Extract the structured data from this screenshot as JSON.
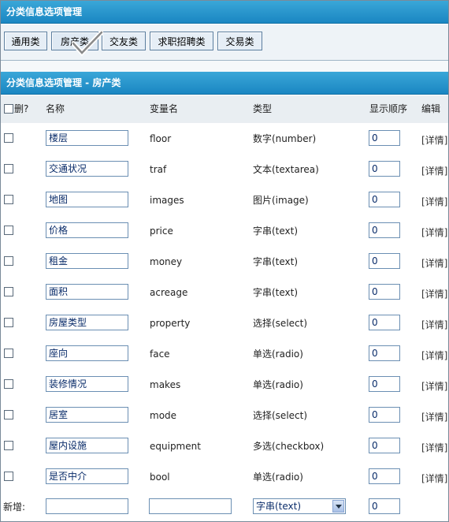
{
  "top_title": "分类信息选项管理",
  "tabs": [
    {
      "label": "通用类"
    },
    {
      "label": "房产类"
    },
    {
      "label": "交友类"
    },
    {
      "label": "求职招聘类"
    },
    {
      "label": "交易类"
    }
  ],
  "section_title": "分类信息选项管理 - 房产类",
  "columns": {
    "del": "删?",
    "name": "名称",
    "var": "变量名",
    "type": "类型",
    "order": "显示顺序",
    "edit": "编辑"
  },
  "rows": [
    {
      "name": "楼层",
      "var": "floor",
      "type": "数字(number)",
      "order": "0",
      "edit": "[详情]"
    },
    {
      "name": "交通状况",
      "var": "traf",
      "type": "文本(textarea)",
      "order": "0",
      "edit": "[详情]"
    },
    {
      "name": "地图",
      "var": "images",
      "type": "图片(image)",
      "order": "0",
      "edit": "[详情]"
    },
    {
      "name": "价格",
      "var": "price",
      "type": "字串(text)",
      "order": "0",
      "edit": "[详情]"
    },
    {
      "name": "租金",
      "var": "money",
      "type": "字串(text)",
      "order": "0",
      "edit": "[详情]"
    },
    {
      "name": "面积",
      "var": "acreage",
      "type": "字串(text)",
      "order": "0",
      "edit": "[详情]"
    },
    {
      "name": "房屋类型",
      "var": "property",
      "type": "选择(select)",
      "order": "0",
      "edit": "[详情]"
    },
    {
      "name": "座向",
      "var": "face",
      "type": "单选(radio)",
      "order": "0",
      "edit": "[详情]"
    },
    {
      "name": "装修情况",
      "var": "makes",
      "type": "单选(radio)",
      "order": "0",
      "edit": "[详情]"
    },
    {
      "name": "居室",
      "var": "mode",
      "type": "选择(select)",
      "order": "0",
      "edit": "[详情]"
    },
    {
      "name": "屋内设施",
      "var": "equipment",
      "type": "多选(checkbox)",
      "order": "0",
      "edit": "[详情]"
    },
    {
      "name": "是否中介",
      "var": "bool",
      "type": "单选(radio)",
      "order": "0",
      "edit": "[详情]"
    }
  ],
  "new_row": {
    "label": "新增:",
    "type_selected": "字串(text)",
    "order": "0"
  },
  "colors": {
    "header": "#1a86c2",
    "border": "#6b8fb3"
  },
  "icons": {
    "active_tab_mark": "checkmark-icon",
    "select_arrow": "chevron-down-icon"
  }
}
